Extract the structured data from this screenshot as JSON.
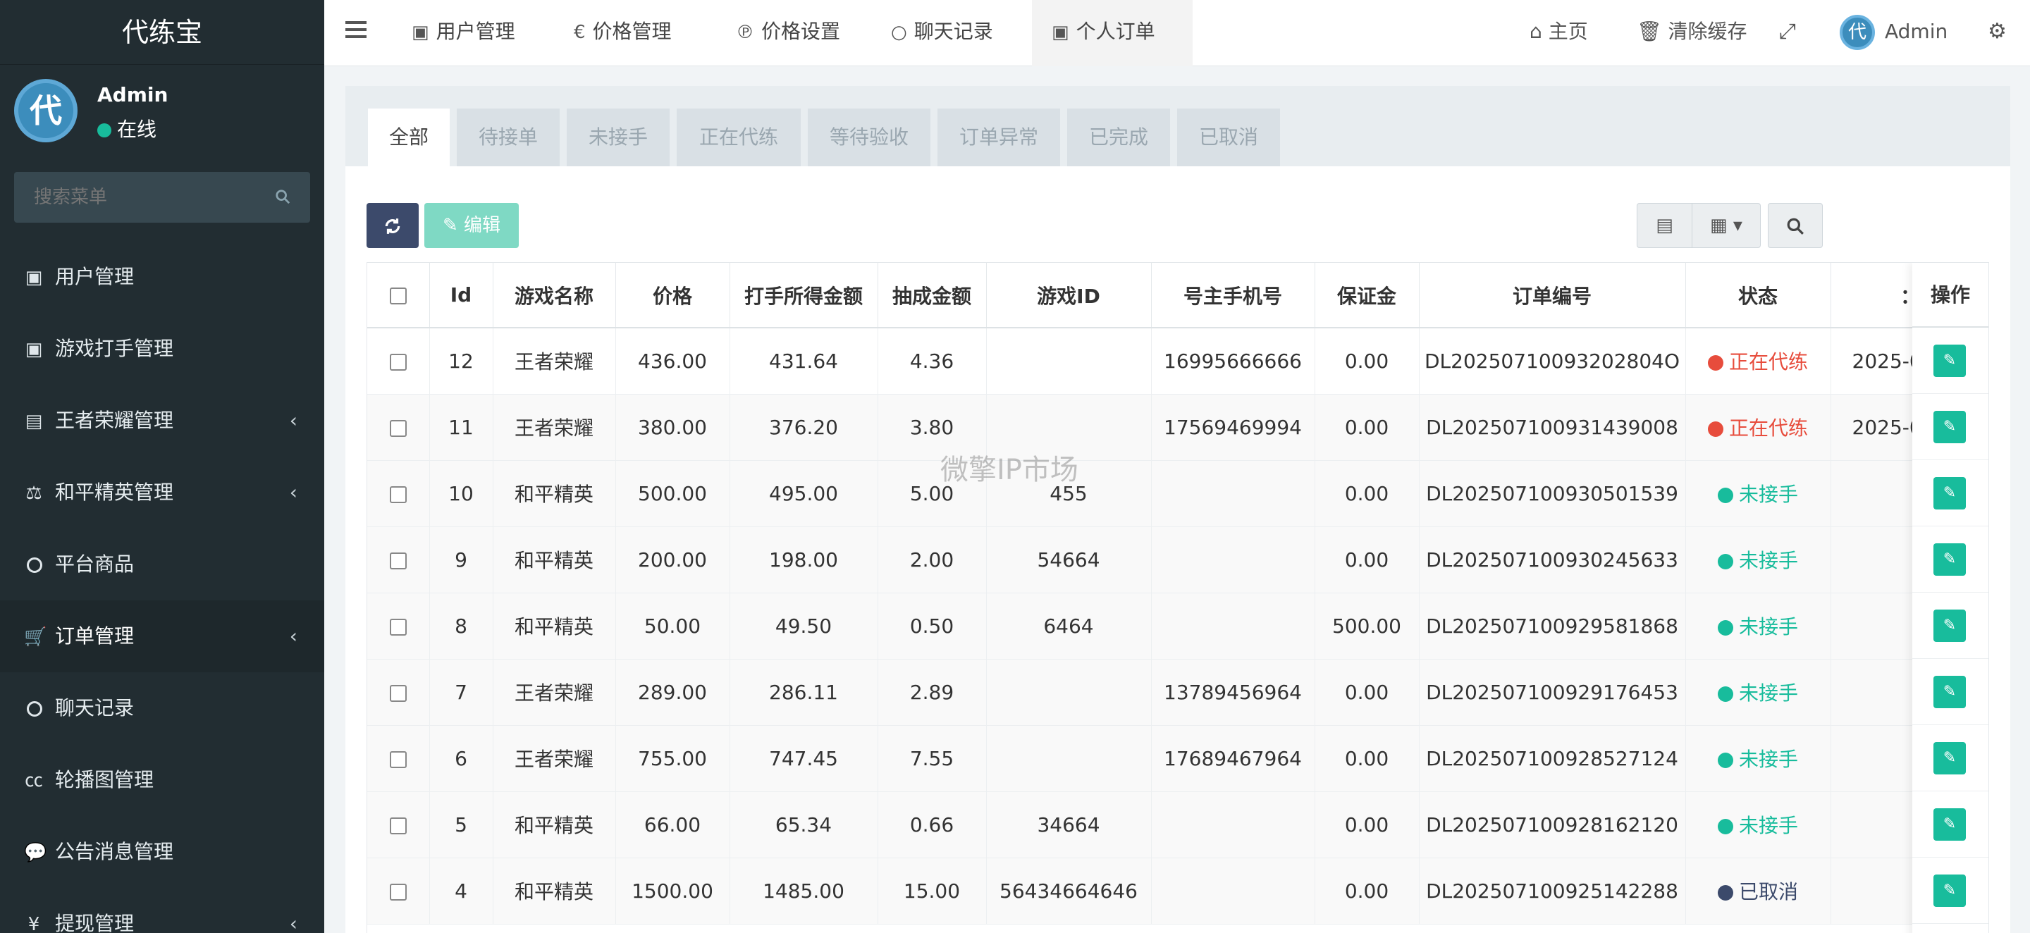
{
  "app": {
    "title": "代练宝",
    "user_name": "Admin",
    "user_status": "在线",
    "avatar_text": "代"
  },
  "sidebar": {
    "search_placeholder": "搜索菜单",
    "items": [
      {
        "label": "用户管理",
        "icon": "user-card-icon"
      },
      {
        "label": "游戏打手管理",
        "icon": "user-card-icon"
      },
      {
        "label": "王者荣耀管理",
        "icon": "id-card-icon",
        "arrow": "‹"
      },
      {
        "label": "和平精英管理",
        "icon": "scale-icon",
        "arrow": "‹"
      },
      {
        "label": "平台商品",
        "icon": "circle-icon"
      },
      {
        "label": "订单管理",
        "icon": "cart-icon",
        "arrow": "‹"
      },
      {
        "label": "聊天记录",
        "icon": "circle-icon"
      },
      {
        "label": "轮播图管理",
        "icon": "cc-icon"
      },
      {
        "label": "公告消息管理",
        "icon": "comment-icon"
      },
      {
        "label": "提现管理",
        "icon": "yen-icon",
        "arrow": "‹"
      }
    ]
  },
  "navbar": {
    "tabs": [
      {
        "label": "用户管理",
        "icon": "user-card-icon"
      },
      {
        "label": "价格管理",
        "icon": "euro-icon"
      },
      {
        "label": "价格设置",
        "icon": "paypal-icon"
      },
      {
        "label": "聊天记录",
        "icon": "circle-icon"
      },
      {
        "label": "个人订单",
        "icon": "user-card-icon"
      }
    ],
    "home_label": "主页",
    "clear_cache_label": "清除缓存",
    "user_label": "Admin",
    "avatar_text": "代"
  },
  "status_tabs": [
    "全部",
    "待接单",
    "未接手",
    "正在代练",
    "等待验收",
    "订单异常",
    "已完成",
    "已取消"
  ],
  "toolbar": {
    "edit_label": "编辑"
  },
  "table": {
    "headers": [
      "Id",
      "游戏名称",
      "价格",
      "打手所得金额",
      "抽成金额",
      "游戏ID",
      "号主手机号",
      "保证金",
      "订单编号",
      "状态",
      "："
    ],
    "op_header": "操作",
    "rows": [
      {
        "id": "12",
        "game": "王者荣耀",
        "price": "436.00",
        "earn": "431.64",
        "commission": "4.36",
        "game_id": "",
        "phone": "16995666666",
        "deposit": "0.00",
        "order_no": "DL20250710093202804O",
        "status": "正在代练",
        "status_color": "#e74c3c",
        "date": "2025-0"
      },
      {
        "id": "11",
        "game": "王者荣耀",
        "price": "380.00",
        "earn": "376.20",
        "commission": "3.80",
        "game_id": "",
        "phone": "17569469994",
        "deposit": "0.00",
        "order_no": "DL202507100931439008",
        "status": "正在代练",
        "status_color": "#e74c3c",
        "date": "2025-0"
      },
      {
        "id": "10",
        "game": "和平精英",
        "price": "500.00",
        "earn": "495.00",
        "commission": "5.00",
        "game_id": "455",
        "phone": "",
        "deposit": "0.00",
        "order_no": "DL202507100930501539",
        "status": "未接手",
        "status_color": "#18bc9c",
        "date": ""
      },
      {
        "id": "9",
        "game": "和平精英",
        "price": "200.00",
        "earn": "198.00",
        "commission": "2.00",
        "game_id": "54664",
        "phone": "",
        "deposit": "0.00",
        "order_no": "DL202507100930245633",
        "status": "未接手",
        "status_color": "#18bc9c",
        "date": ""
      },
      {
        "id": "8",
        "game": "和平精英",
        "price": "50.00",
        "earn": "49.50",
        "commission": "0.50",
        "game_id": "6464",
        "phone": "",
        "deposit": "500.00",
        "order_no": "DL202507100929581868",
        "status": "未接手",
        "status_color": "#18bc9c",
        "date": ""
      },
      {
        "id": "7",
        "game": "王者荣耀",
        "price": "289.00",
        "earn": "286.11",
        "commission": "2.89",
        "game_id": "",
        "phone": "13789456964",
        "deposit": "0.00",
        "order_no": "DL202507100929176453",
        "status": "未接手",
        "status_color": "#18bc9c",
        "date": ""
      },
      {
        "id": "6",
        "game": "王者荣耀",
        "price": "755.00",
        "earn": "747.45",
        "commission": "7.55",
        "game_id": "",
        "phone": "17689467964",
        "deposit": "0.00",
        "order_no": "DL202507100928527124",
        "status": "未接手",
        "status_color": "#18bc9c",
        "date": ""
      },
      {
        "id": "5",
        "game": "和平精英",
        "price": "66.00",
        "earn": "65.34",
        "commission": "0.66",
        "game_id": "34664",
        "phone": "",
        "deposit": "0.00",
        "order_no": "DL202507100928162120",
        "status": "未接手",
        "status_color": "#18bc9c",
        "date": ""
      },
      {
        "id": "4",
        "game": "和平精英",
        "price": "1500.00",
        "earn": "1485.00",
        "commission": "15.00",
        "game_id": "56434664646",
        "phone": "",
        "deposit": "0.00",
        "order_no": "DL202507100925142288",
        "status": "已取消",
        "status_color": "#3c4a6b",
        "date": ""
      }
    ]
  },
  "watermark": "微擎IP市场",
  "colors": {
    "sidebar_bg": "#222d32",
    "primary": "#3c8dbc",
    "success": "#18bc9c",
    "danger": "#e74c3c",
    "dark_btn": "#3c4a6b"
  }
}
